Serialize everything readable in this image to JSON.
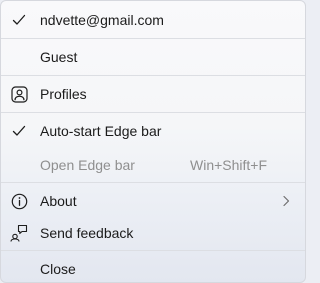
{
  "account": {
    "email": "ndvette@gmail.com"
  },
  "menu": {
    "guest": "Guest",
    "profiles": "Profiles",
    "auto_start": "Auto-start Edge bar",
    "open_edge_bar": "Open Edge bar",
    "open_edge_bar_shortcut": "Win+Shift+F",
    "about": "About",
    "send_feedback": "Send feedback",
    "close": "Close"
  },
  "icons": {
    "account_check": "checkmark-icon",
    "profiles": "profile-icon",
    "auto_start_check": "checkmark-icon",
    "about": "info-icon",
    "about_arrow": "chevron-right-icon",
    "feedback": "feedback-icon"
  },
  "state": {
    "account_checked": true,
    "auto_start_checked": true,
    "open_edge_bar_enabled": false
  }
}
